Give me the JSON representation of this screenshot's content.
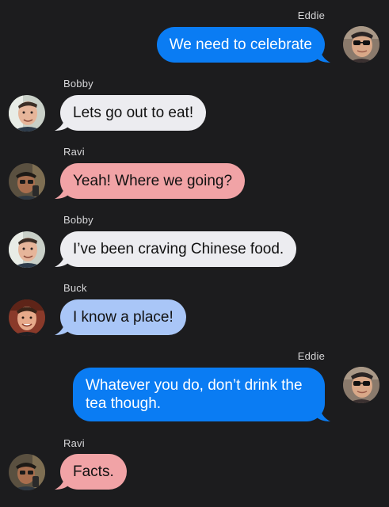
{
  "conversation": {
    "messages": [
      {
        "sender": "Eddie",
        "text": "We need to celebrate",
        "direction": "out"
      },
      {
        "sender": "Bobby",
        "text": "Lets go out to eat!",
        "direction": "in"
      },
      {
        "sender": "Ravi",
        "text": "Yeah! Where we going?",
        "direction": "in"
      },
      {
        "sender": "Bobby",
        "text": "I’ve been craving Chinese food.",
        "direction": "in"
      },
      {
        "sender": "Buck",
        "text": "I know a place!",
        "direction": "in"
      },
      {
        "sender": "Eddie",
        "text": "Whatever you do, don’t drink the tea though.",
        "direction": "out"
      },
      {
        "sender": "Ravi",
        "text": "Facts.",
        "direction": "in"
      }
    ]
  },
  "colors": {
    "background": "#1c1c1e",
    "outgoing_bubble": "#0a7cf3",
    "bobby_bubble": "#ececf0",
    "ravi_bubble": "#f1a3a6",
    "buck_bubble": "#a9c6f7"
  },
  "icons": {
    "eddie_avatar": "avatar-eddie",
    "bobby_avatar": "avatar-bobby",
    "ravi_avatar": "avatar-ravi",
    "buck_avatar": "avatar-buck"
  }
}
